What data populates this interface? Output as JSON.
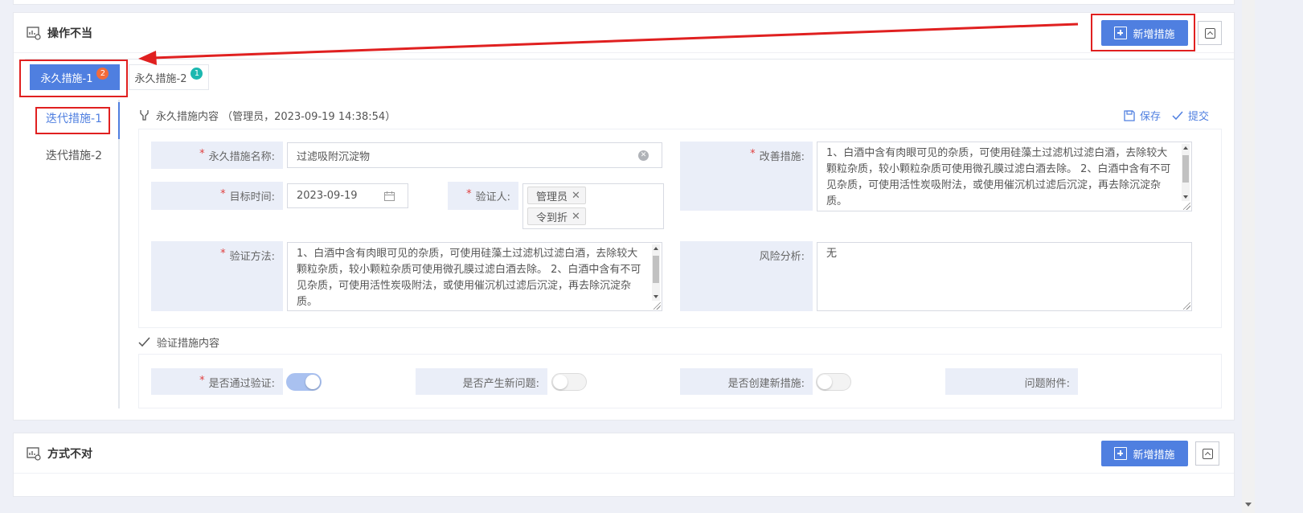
{
  "section1": {
    "title": "操作不当",
    "add_button": "新增措施",
    "tabs": [
      {
        "label": "永久措施-1",
        "badge": "2",
        "badge_color": "#f26b3a"
      },
      {
        "label": "永久措施-2",
        "badge": "1",
        "badge_color": "#1bb8b0"
      }
    ],
    "side_items": [
      "迭代措施-1",
      "迭代措施-2"
    ],
    "content_header": "永久措施内容  （管理员，2023-09-19 14:38:54）",
    "save_label": "保存",
    "submit_label": "提交",
    "fields": {
      "name_label": "永久措施名称:",
      "name_value": "过滤吸附沉淀物",
      "target_time_label": "目标时间:",
      "target_time_value": "2023-09-19",
      "verifier_label": "验证人:",
      "verifiers": [
        "管理员",
        "令到折"
      ],
      "method_label": "验证方法:",
      "method_value": "1、白酒中含有肉眼可见的杂质，可使用硅藻土过滤机过滤白酒，去除较大颗粒杂质，较小颗粒杂质可使用微孔膜过滤白酒去除。 2、白酒中含有不可见杂质，可使用活性炭吸附法，或使用催沉机过滤后沉淀，再去除沉淀杂质。",
      "improve_label": "改善措施:",
      "improve_value": "1、白酒中含有肉眼可见的杂质，可使用硅藻土过滤机过滤白酒，去除较大颗粒杂质，较小颗粒杂质可使用微孔膜过滤白酒去除。 2、白酒中含有不可见杂质，可使用活性炭吸附法，或使用催沉机过滤后沉淀，再去除沉淀杂质。",
      "risk_label": "风险分析:",
      "risk_value": "无"
    },
    "verify_header": "验证措施内容",
    "verify": {
      "passed_label": "是否通过验证:",
      "passed": true,
      "new_issue_label": "是否产生新问题:",
      "new_issue": false,
      "new_measure_label": "是否创建新措施:",
      "new_measure": false,
      "attachment_label": "问题附件:"
    }
  },
  "section2": {
    "title": "方式不对",
    "add_button": "新增措施"
  },
  "colors": {
    "primary": "#4f7fe0",
    "annotation_red": "#e02020",
    "label_bg": "#eaeef8"
  }
}
